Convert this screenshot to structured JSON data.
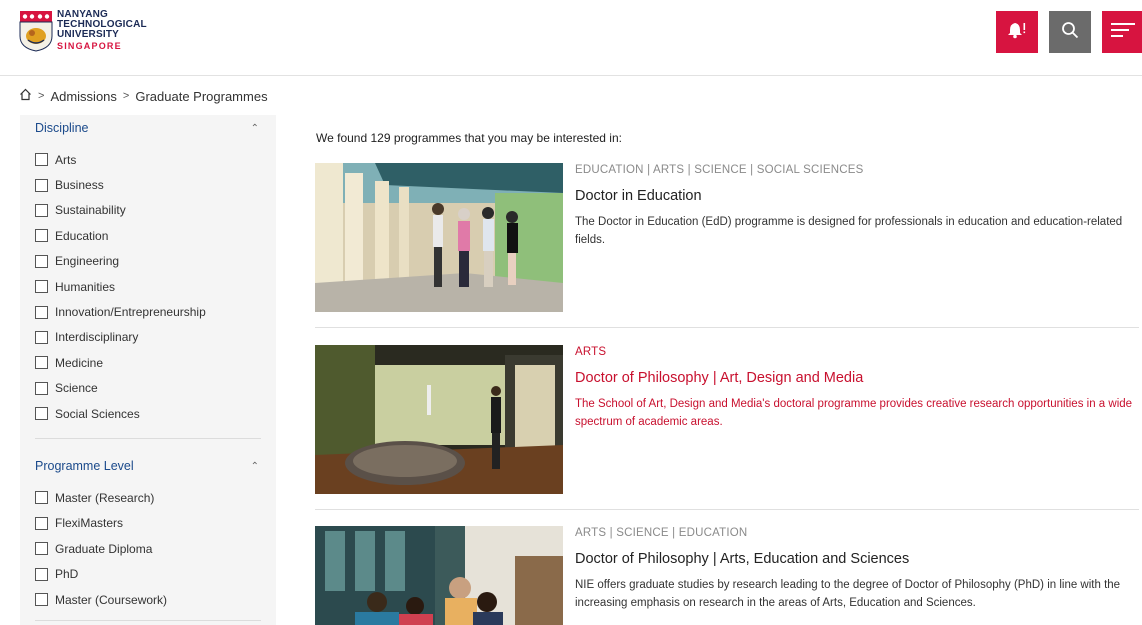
{
  "header": {
    "logo": {
      "line1": "NANYANG",
      "line2": "TECHNOLOGICAL",
      "line3": "UNIVERSITY",
      "line4": "SINGAPORE"
    },
    "buttons": [
      {
        "name": "notification",
        "icon": "bell-icon",
        "color": "#d71440"
      },
      {
        "name": "search",
        "icon": "search-icon",
        "color": "#6b6b6b"
      },
      {
        "name": "menu",
        "icon": "hamburger-icon",
        "color": "#d71440"
      }
    ]
  },
  "breadcrumb": {
    "home_icon": "home-icon",
    "items": [
      "Admissions",
      "Graduate Programmes"
    ]
  },
  "filters": {
    "discipline": {
      "title": "Discipline",
      "options": [
        "Arts",
        "Business",
        "Sustainability",
        "Education",
        "Engineering",
        "Humanities",
        "Innovation/Entrepreneurship",
        "Interdisciplinary",
        "Medicine",
        "Science",
        "Social Sciences"
      ]
    },
    "level": {
      "title": "Programme Level",
      "options": [
        "Master (Research)",
        "FlexiMasters",
        "Graduate Diploma",
        "PhD",
        "Master (Coursework)"
      ]
    }
  },
  "results": {
    "summary": "We found 129 programmes that you may be interested in:",
    "programmes": [
      {
        "categories": "EDUCATION | ARTS | SCIENCE | SOCIAL SCIENCES",
        "title": "Doctor in Education",
        "description": "The Doctor in Education (EdD) programme is designed for professionals in education and education-related fields."
      },
      {
        "categories": "ARTS",
        "title": "Doctor of Philosophy | Art, Design and Media",
        "description": "The School of Art, Design and Media's doctoral programme provides creative research opportunities in a wide spectrum of academic areas."
      },
      {
        "categories": "ARTS | SCIENCE | EDUCATION",
        "title": "Doctor of Philosophy | Arts, Education and Sciences",
        "description": "NIE offers graduate studies by research leading to the degree of Doctor of Philosophy (PhD) in line with the increasing emphasis on research in the areas of Arts, Education and Sciences."
      }
    ]
  },
  "colors": {
    "accent": "#d71440",
    "link": "#1b4a8b",
    "active_card": "#c8102e"
  }
}
